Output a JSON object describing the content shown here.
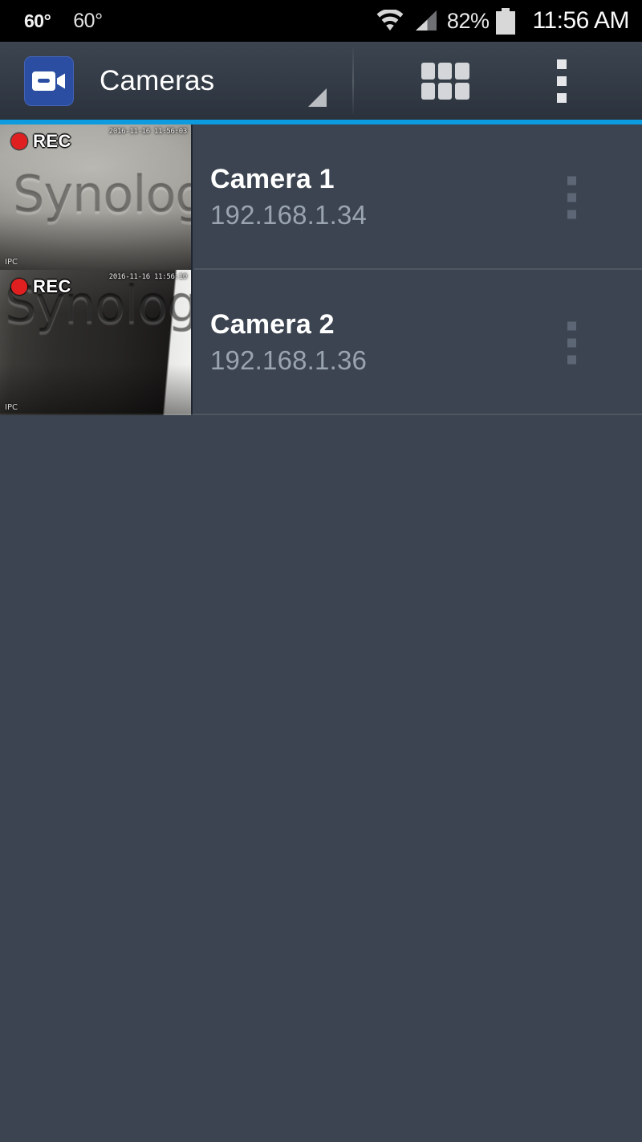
{
  "status_bar": {
    "temp_primary": "60°",
    "temp_secondary": "60°",
    "wifi_icon": "wifi-icon",
    "signal_icon": "cellular-signal-icon",
    "battery_percent": "82%",
    "battery_icon": "battery-icon",
    "clock": "11:56 AM"
  },
  "app_bar": {
    "app_icon": "camcorder-app-icon",
    "title": "Cameras",
    "spinner_caret_icon": "dropdown-caret-icon",
    "grid_view_icon": "grid-view-icon",
    "overflow_menu_icon": "overflow-menu-icon",
    "accent_color": "#0d9be0"
  },
  "camera_list": {
    "rows": [
      {
        "name": "Camera 1",
        "ip": "192.168.1.34",
        "rec_label": "REC",
        "timestamp": "2016-11-16 11:56:03",
        "source_label": "IPC",
        "emboss_text": "Synology",
        "overflow_icon": "row-overflow-menu-icon"
      },
      {
        "name": "Camera 2",
        "ip": "192.168.1.36",
        "rec_label": "REC",
        "timestamp": "2016-11-16 11:56:10",
        "source_label": "IPC",
        "emboss_text": "Synology",
        "overflow_icon": "row-overflow-menu-icon"
      }
    ]
  },
  "colors": {
    "background": "#3b4450",
    "accent": "#0d9be0",
    "app_icon_blue": "#2b4ea2",
    "rec_red": "#e02020",
    "ip_text": "#9aa4b0"
  }
}
